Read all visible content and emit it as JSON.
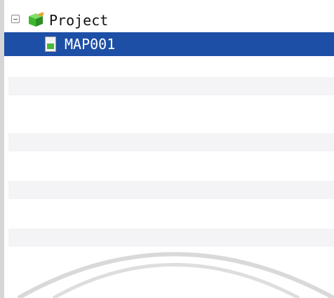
{
  "tree": {
    "root": {
      "label": "Project",
      "icon": "cube-project-icon",
      "expanded": true
    },
    "children": [
      {
        "label": "MAP001",
        "icon": "map-file-icon",
        "selected": true
      }
    ]
  },
  "colors": {
    "selection": "#1e4fa6",
    "project_icon_green": "#3db82e",
    "map_icon_green": "#49b83a"
  }
}
